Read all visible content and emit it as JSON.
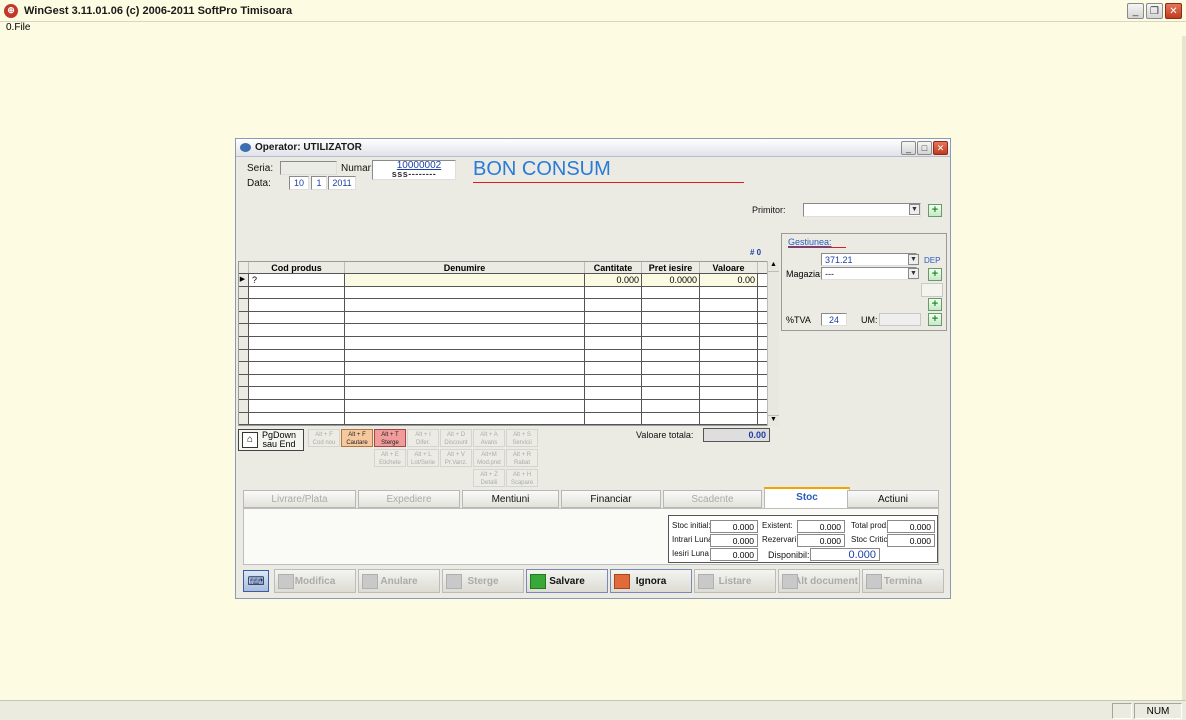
{
  "app": {
    "title": "WinGest 3.11.01.06  (c) 2006-2011 SoftPro Timisoara",
    "icon": "app-logo-icon"
  },
  "menu": {
    "file": "0.File"
  },
  "status": {
    "num": "NUM"
  },
  "dialog": {
    "title": "Operator: UTILIZATOR",
    "header": {
      "seria_label": "Seria:",
      "seria_value": "",
      "numar_label": "Numar:",
      "numar_value": "10000002",
      "numar_mask": "sss--------",
      "data_label": "Data:",
      "day": "10",
      "month": "1",
      "year": "2011",
      "doc_title": "BON CONSUM",
      "primitor_label": "Primitor:",
      "primitor_value": "",
      "count": "# 0"
    },
    "grid": {
      "columns": [
        "Cod produs",
        "Denumire",
        "Cantitate",
        "Pret iesire",
        "Valoare"
      ],
      "first_row": {
        "cod": "?",
        "denumire": "",
        "cantitate": "0.000",
        "pret": "0.0000",
        "valoare": "0.00"
      },
      "empty_rows": 11
    },
    "gestiune": {
      "title": "Gestiunea:",
      "value": "371.21",
      "dep": "DEP",
      "magazia_label": "Magazia:",
      "magazia_value": "---",
      "tva_label": "%TVA",
      "tva_value": "24",
      "um_label": "UM:"
    },
    "pgdown": {
      "line1": "PgDown",
      "line2": "sau End"
    },
    "shortcuts": [
      {
        "key": "Alt + F",
        "label": "Cod nou"
      },
      {
        "key": "Alt + F",
        "label": "Cautare"
      },
      {
        "key": "Alt + T",
        "label": "Sterge"
      },
      {
        "key": "Alt + I",
        "label": "Difer."
      },
      {
        "key": "Alt + D",
        "label": "Discount"
      },
      {
        "key": "Alt + A",
        "label": "Avans"
      },
      {
        "key": "Alt + S",
        "label": "Servicii"
      },
      {
        "key": "Alt + E",
        "label": "Etichete"
      },
      {
        "key": "Alt + L",
        "label": "Lot/Serie"
      },
      {
        "key": "Alt + V",
        "label": "Pr.Vanz."
      },
      {
        "key": "Alt+M",
        "label": "Mod.pret"
      },
      {
        "key": "Alt + R",
        "label": "Rabat"
      },
      {
        "key": "Alt + Z",
        "label": "Detalii"
      },
      {
        "key": "Alt + H",
        "label": "Scapare"
      }
    ],
    "total": {
      "label": "Valoare totala:",
      "value": "0.00"
    },
    "tabs": [
      "Livrare/Plata",
      "Expediere",
      "Mentiuni",
      "Financiar",
      "Scadente",
      "Stoc",
      "Actiuni"
    ],
    "stoc": {
      "initial_label": "Stoc initial:",
      "initial": "0.000",
      "intrari_label": "Intrari Luna",
      "intrari": "0.000",
      "iesiri_label": "Iesiri Luna",
      "iesiri": "0.000",
      "existent_label": "Existent:",
      "existent": "0.000",
      "rezervari_label": "Rezervari:",
      "rezervari": "0.000",
      "disponibil_label": "Disponibil:",
      "disponibil": "0.000",
      "total_label": "Total prod.:",
      "total": "0.000",
      "critic_label": "Stoc Critic:",
      "critic": "0.000"
    },
    "buttons": [
      "Modifica",
      "Anulare",
      "Sterge",
      "Salvare",
      "Ignora",
      "Listare",
      "Alt document",
      "Termina"
    ]
  },
  "colors": {
    "background": "#fdfbe1",
    "doc_title": "#2a7bd8",
    "accent_line": "#d62020",
    "tab_active": "#2a5bc0"
  }
}
